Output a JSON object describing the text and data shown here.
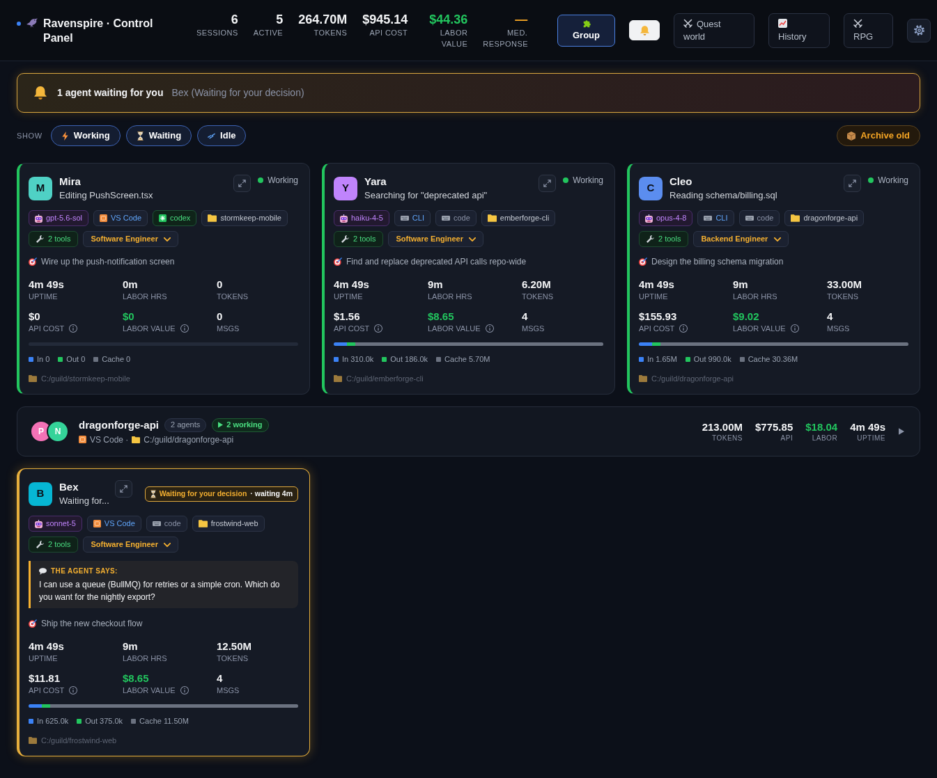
{
  "header": {
    "title": "Ravenspire · Control Panel",
    "stats": [
      {
        "value": "6",
        "label": "SESSIONS",
        "kind": "plain"
      },
      {
        "value": "5",
        "label": "ACTIVE",
        "kind": "plain"
      },
      {
        "value": "264.70M",
        "label": "TOKENS",
        "kind": "plain"
      },
      {
        "value": "$945.14",
        "label": "API COST",
        "kind": "plain"
      },
      {
        "value": "$44.36",
        "label": "LABOR VALUE",
        "kind": "money"
      },
      {
        "value": "—",
        "label": "MED. RESPONSE",
        "kind": "pending"
      }
    ],
    "buttons": [
      {
        "kind": "group",
        "label": "Group",
        "selected": true
      },
      {
        "kind": "alerts",
        "selected": true
      },
      {
        "kind": "quest",
        "label": "Quest world",
        "selected": false
      },
      {
        "kind": "history",
        "label": "History",
        "selected": false
      },
      {
        "kind": "rpg",
        "label": "RPG",
        "selected": false
      },
      {
        "kind": "settings",
        "selected": false
      }
    ]
  },
  "alert": {
    "title": "1 agent waiting for you",
    "detail": "Bex (Waiting for your decision)"
  },
  "filters": {
    "label": "SHOW",
    "chips": [
      {
        "kind": "working",
        "label": "Working",
        "selected": true
      },
      {
        "kind": "waiting",
        "label": "Waiting",
        "selected": true
      },
      {
        "kind": "idle",
        "label": "Idle",
        "selected": true
      }
    ],
    "archive": "Archive old"
  },
  "rows": [
    {
      "kind": "cards",
      "cards": [
        {
          "name": "Mira",
          "initial": "M",
          "color": "#4fd1c5",
          "activity": "Editing PushScreen.tsx",
          "status": {
            "kind": "working",
            "label": "Working"
          },
          "tags": [
            {
              "kind": "model",
              "label": "gpt-5.6-sol"
            },
            {
              "kind": "editor",
              "label": "VS Code"
            },
            {
              "kind": "codex",
              "label": "codex"
            },
            {
              "kind": "folder",
              "label": "stormkeep-mobile"
            }
          ],
          "tools": "2 tools",
          "role": "Software Engineer",
          "goal": "Wire up the push-notification screen",
          "stats": [
            {
              "value": "4m 49s",
              "label": "UPTIME",
              "kind": "plain",
              "info": false
            },
            {
              "value": "0m",
              "label": "LABOR HRS",
              "kind": "plain",
              "info": false
            },
            {
              "value": "0",
              "label": "TOKENS",
              "kind": "plain",
              "info": false
            },
            {
              "value": "$0",
              "label": "API COST",
              "kind": "plain",
              "info": true
            },
            {
              "value": "$0",
              "label": "LABOR VALUE",
              "kind": "money",
              "info": true
            },
            {
              "value": "0",
              "label": "MSGS",
              "kind": "plain",
              "info": false
            }
          ],
          "legend": [
            {
              "label": "In 0",
              "color": "#3b82f6"
            },
            {
              "label": "Out 0",
              "color": "#22c55e"
            },
            {
              "label": "Cache 0",
              "color": "#6b7280"
            }
          ],
          "path": "C:/guild/stormkeep-mobile"
        },
        {
          "name": "Yara",
          "initial": "Y",
          "color": "#c084fc",
          "activity": "Searching for \"deprecated api\"",
          "status": {
            "kind": "working",
            "label": "Working"
          },
          "tags": [
            {
              "kind": "model",
              "label": "haiku-4-5"
            },
            {
              "kind": "terminal",
              "label": "CLI"
            },
            {
              "kind": "code",
              "label": "code"
            },
            {
              "kind": "folder",
              "label": "emberforge-cli"
            }
          ],
          "tools": "2 tools",
          "role": "Software Engineer",
          "goal": "Find and replace deprecated API calls repo-wide",
          "stats": [
            {
              "value": "4m 49s",
              "label": "UPTIME",
              "kind": "plain",
              "info": false
            },
            {
              "value": "9m",
              "label": "LABOR HRS",
              "kind": "plain",
              "info": false
            },
            {
              "value": "6.20M",
              "label": "TOKENS",
              "kind": "plain",
              "info": false
            },
            {
              "value": "$1.56",
              "label": "API COST",
              "kind": "plain",
              "info": true
            },
            {
              "value": "$8.65",
              "label": "LABOR VALUE",
              "kind": "money",
              "info": true
            },
            {
              "value": "4",
              "label": "MSGS",
              "kind": "plain",
              "info": false
            }
          ],
          "bar": [
            {
              "level": 0.05
            },
            {
              "level": 0.03
            },
            {
              "level": 0.92
            }
          ],
          "legend": [
            {
              "label": "In 310.0k",
              "color": "#3b82f6"
            },
            {
              "label": "Out 186.0k",
              "color": "#22c55e"
            },
            {
              "label": "Cache 5.70M",
              "color": "#6b7280"
            }
          ],
          "path": "C:/guild/emberforge-cli"
        },
        {
          "name": "Cleo",
          "initial": "C",
          "color": "#5b8def",
          "activity": "Reading schema/billing.sql",
          "status": {
            "kind": "working",
            "label": "Working"
          },
          "tags": [
            {
              "kind": "model",
              "label": "opus-4-8"
            },
            {
              "kind": "terminal",
              "label": "CLI"
            },
            {
              "kind": "code",
              "label": "code"
            },
            {
              "kind": "folder",
              "label": "dragonforge-api"
            }
          ],
          "tools": "2 tools",
          "role": "Backend Engineer",
          "goal": "Design the billing schema migration",
          "stats": [
            {
              "value": "4m 49s",
              "label": "UPTIME",
              "kind": "plain",
              "info": false
            },
            {
              "value": "9m",
              "label": "LABOR HRS",
              "kind": "plain",
              "info": false
            },
            {
              "value": "33.00M",
              "label": "TOKENS",
              "kind": "plain",
              "info": false
            },
            {
              "value": "$155.93",
              "label": "API COST",
              "kind": "plain",
              "info": true
            },
            {
              "value": "$9.02",
              "label": "LABOR VALUE",
              "kind": "money",
              "info": true
            },
            {
              "value": "4",
              "label": "MSGS",
              "kind": "plain",
              "info": false
            }
          ],
          "bar": [
            {
              "level": 0.05
            },
            {
              "level": 0.03
            },
            {
              "level": 0.92
            }
          ],
          "legend": [
            {
              "label": "In 1.65M",
              "color": "#3b82f6"
            },
            {
              "label": "Out 990.0k",
              "color": "#22c55e"
            },
            {
              "label": "Cache 30.36M",
              "color": "#6b7280"
            }
          ],
          "path": "C:/guild/dragonforge-api"
        }
      ]
    },
    {
      "kind": "group",
      "name": "dragonforge-api",
      "members": [
        {
          "initial": "P",
          "color": "#f472b6"
        },
        {
          "initial": "N",
          "color": "#34d399"
        }
      ],
      "count": "2 agents",
      "working": "2 working",
      "editor": "VS Code ·",
      "path": "C:/guild/dragonforge-api",
      "stats": [
        {
          "value": "213.00M",
          "label": "TOKENS",
          "kind": "plain"
        },
        {
          "value": "$775.85",
          "label": "API",
          "kind": "plain"
        },
        {
          "value": "$18.04",
          "label": "LABOR",
          "kind": "money"
        },
        {
          "value": "4m 49s",
          "label": "UPTIME",
          "kind": "plain"
        }
      ],
      "expanded": false
    },
    {
      "kind": "cards",
      "cards": [
        {
          "name": "Bex",
          "initial": "B",
          "color": "#06b6d4",
          "activity": "Waiting for...",
          "status": {
            "kind": "waiting",
            "label": "Waiting for your decision",
            "wait": "· waiting 4m"
          },
          "tags": [
            {
              "kind": "model",
              "label": "sonnet-5"
            },
            {
              "kind": "editor",
              "label": "VS Code"
            },
            {
              "kind": "code",
              "label": "code"
            },
            {
              "kind": "folder",
              "label": "frostwind-web"
            }
          ],
          "tools": "2 tools",
          "role": "Software Engineer",
          "message": {
            "heading": "THE AGENT SAYS:",
            "text": "I can use a queue (BullMQ) for retries or a simple cron. Which do you want for the nightly export?"
          },
          "goal": "Ship the new checkout flow",
          "stats": [
            {
              "value": "4m 49s",
              "label": "UPTIME",
              "kind": "plain",
              "info": false
            },
            {
              "value": "9m",
              "label": "LABOR HRS",
              "kind": "plain",
              "info": false
            },
            {
              "value": "12.50M",
              "label": "TOKENS",
              "kind": "plain",
              "info": false
            },
            {
              "value": "$11.81",
              "label": "API COST",
              "kind": "plain",
              "info": true
            },
            {
              "value": "$8.65",
              "label": "LABOR VALUE",
              "kind": "money",
              "info": true
            },
            {
              "value": "4",
              "label": "MSGS",
              "kind": "plain",
              "info": false
            }
          ],
          "bar": [
            {
              "level": 0.05
            },
            {
              "level": 0.03
            },
            {
              "level": 0.92
            }
          ],
          "legend": [
            {
              "label": "In 625.0k",
              "color": "#3b82f6"
            },
            {
              "label": "Out 375.0k",
              "color": "#22c55e"
            },
            {
              "label": "Cache 11.50M",
              "color": "#6b7280"
            }
          ],
          "path": "C:/guild/frostwind-web"
        }
      ]
    }
  ]
}
